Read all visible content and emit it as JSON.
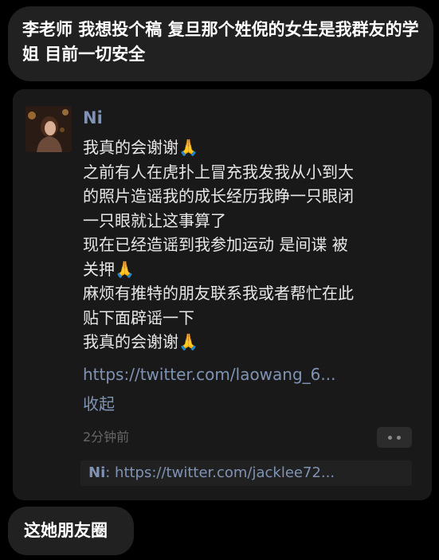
{
  "top_message": {
    "text": "李老师 我想投个稿 复旦那个姓倪的女生是我群友的学姐 目前一切安全"
  },
  "moment": {
    "author": "Ni",
    "lines": [
      {
        "text": "我真的会谢谢",
        "emoji": "🙏"
      },
      {
        "text": "之前有人在虎扑上冒充我发我从小到大",
        "emoji": ""
      },
      {
        "text": "的照片造谣我的成长经历我睁一只眼闭",
        "emoji": ""
      },
      {
        "text": "一只眼就让这事算了",
        "emoji": ""
      },
      {
        "text": "现在已经造谣到我参加运动 是间谍 被",
        "emoji": ""
      },
      {
        "text": "关押",
        "emoji": "🙏"
      },
      {
        "text": "麻烦有推特的朋友联系我或者帮忙在此",
        "emoji": ""
      },
      {
        "text": "贴下面辟谣一下",
        "emoji": ""
      },
      {
        "text": "我真的会谢谢",
        "emoji": "🙏"
      }
    ],
    "link": "https://twitter.com/laowang_6...",
    "collapse_label": "收起",
    "timestamp": "2分钟前",
    "comment": {
      "author": "Ni",
      "separator": ": ",
      "text": "https://twitter.com/jacklee72..."
    }
  },
  "bottom_message": {
    "text": "这她朋友圈"
  },
  "colors": {
    "background": "#000000",
    "bubble": "#212121",
    "card": "#191919",
    "link_blue": "#7f93b4",
    "muted": "#666666"
  }
}
